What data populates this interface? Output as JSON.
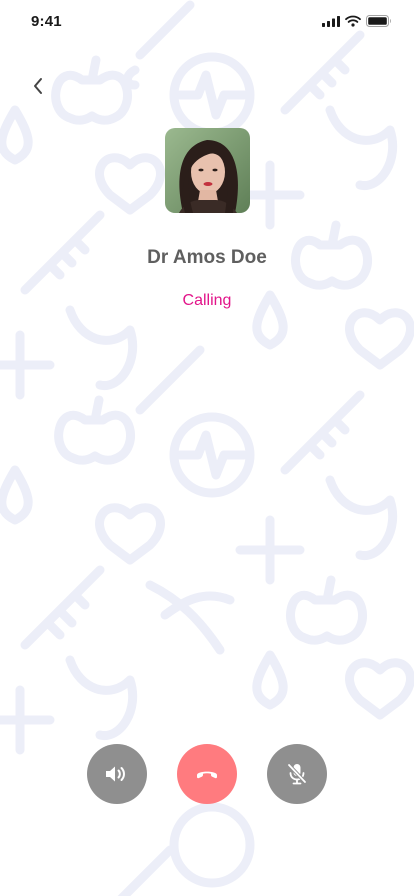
{
  "status_bar": {
    "time": "9:41"
  },
  "caller": {
    "name": "Dr Amos Doe",
    "status": "Calling"
  },
  "colors": {
    "status_text": "#e2158a",
    "name_text": "#5f5f5f",
    "control_gray": "#8f8f8f",
    "end_call_red": "#ff7b7f",
    "pattern": "#eceef8"
  },
  "icons": {
    "back": "chevron-left-icon",
    "speaker": "speaker-icon",
    "end_call": "phone-hangup-icon",
    "mute": "microphone-off-icon"
  }
}
